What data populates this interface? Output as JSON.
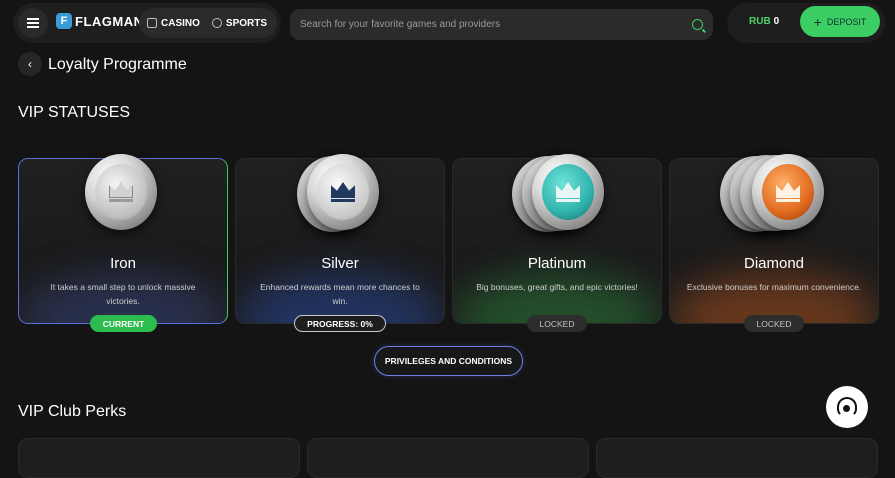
{
  "header": {
    "logo_letter": "F",
    "logo_text": "FLAGMAN",
    "nav": [
      {
        "label": "CASINO",
        "icon": "casino-chip-icon"
      },
      {
        "label": "SPORTS",
        "icon": "soccer-ball-icon"
      }
    ],
    "search_placeholder": "Search for your favorite games and providers",
    "balance_currency": "RUB",
    "balance_amount": "0",
    "deposit_label": "DEPOSIT"
  },
  "page": {
    "title": "Loyalty Programme",
    "vip_section_title": "VIP STATUSES",
    "perks_section_title": "VIP Club Perks",
    "privileges_button": "PRIVILEGES AND CONDITIONS"
  },
  "statuses": [
    {
      "name": "Iron",
      "desc": "It takes a small step to unlock massive victories.",
      "badge": "CURRENT",
      "badge_type": "current",
      "accent": "#5b6fd8",
      "glow": "#3a4a8a"
    },
    {
      "name": "Silver",
      "desc": "Enhanced rewards mean more chances to win.",
      "badge": "PROGRESS: 0%",
      "badge_type": "progress",
      "progress": 0,
      "accent": "#2a4d9a",
      "glow": "#2a4fb0"
    },
    {
      "name": "Platinum",
      "desc": "Big bonuses, great gifts, and epic victories!",
      "badge": "LOCKED",
      "badge_type": "locked",
      "accent": "#2f6e3b",
      "glow": "#2c8a3c"
    },
    {
      "name": "Diamond",
      "desc": "Exclusive bonuses for maximum convenience.",
      "badge": "LOCKED",
      "badge_type": "locked",
      "accent": "#a24d1c",
      "glow": "#c15a1f"
    }
  ],
  "colors": {
    "brand_green": "#3ccd63",
    "background": "#141414",
    "platinum_coin": "#2fb3ad",
    "diamond_coin": "#e06a1e"
  }
}
